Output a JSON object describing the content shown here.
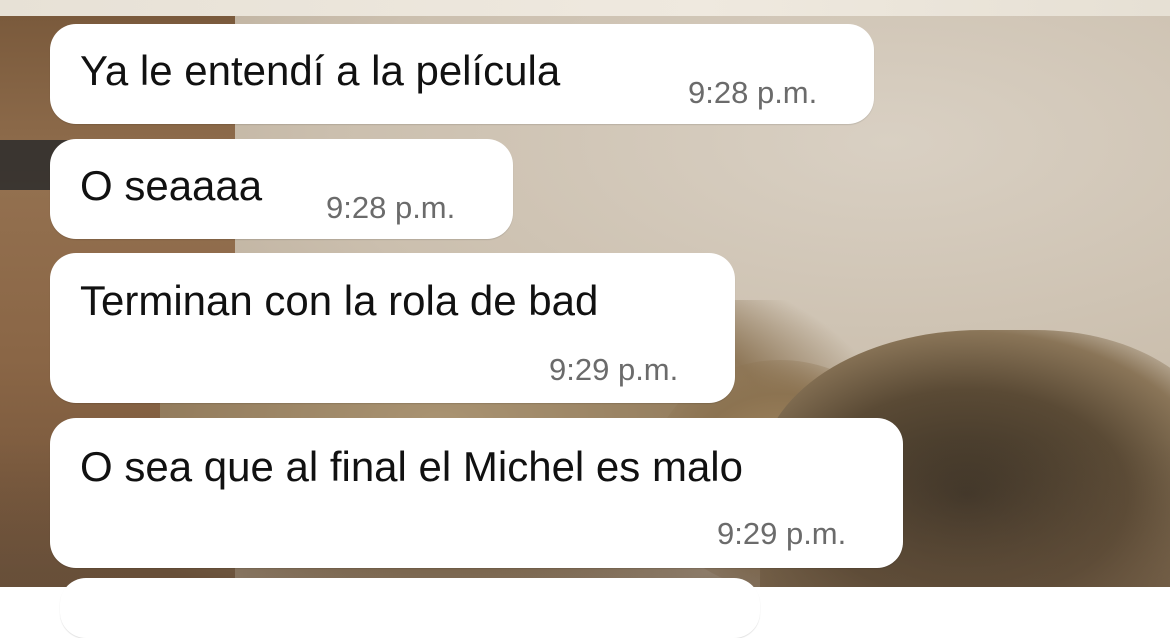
{
  "chat": {
    "messages": [
      {
        "text": "Ya le entendí a la película",
        "time": "9:28 p.m."
      },
      {
        "text": "O seaaaa",
        "time": "9:28 p.m."
      },
      {
        "text": "Terminan con la rola de bad",
        "time": "9:29 p.m."
      },
      {
        "text": "O sea que al final el Michel es malo",
        "time": "9:29 p.m."
      }
    ]
  }
}
